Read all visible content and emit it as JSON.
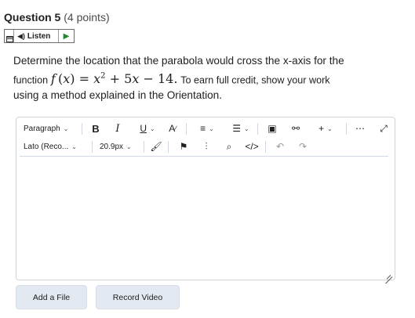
{
  "question": {
    "title": "Question 5",
    "points": "(4 points)"
  },
  "listen": {
    "label": "Listen",
    "speaker_icon": "speaker-icon",
    "play_icon": "play-icon"
  },
  "prompt": {
    "text_before": "Determine the location that the parabola would cross the x-axis for the",
    "function_word": "function",
    "math_f": "f",
    "math_lparen": "(",
    "math_x": "x",
    "math_rparen": ")",
    "math_eq": "=",
    "math_x2": "x",
    "math_exp": "2",
    "math_plus": "+",
    "math_5x": "5x",
    "math_minus": "−",
    "math_14": "14.",
    "text_after": "To earn full credit, show your work",
    "text_line3": "using a method explained in the Orientation."
  },
  "toolbar": {
    "paragraph": "Paragraph",
    "bold": "B",
    "italic": "I",
    "underline": "U",
    "font_family": "Lato (Reco...",
    "font_size": "20.9px",
    "more": "⋯",
    "insert": "+",
    "caret": "⌄"
  },
  "buttons": {
    "add_file": "Add a File",
    "record_video": "Record Video"
  }
}
